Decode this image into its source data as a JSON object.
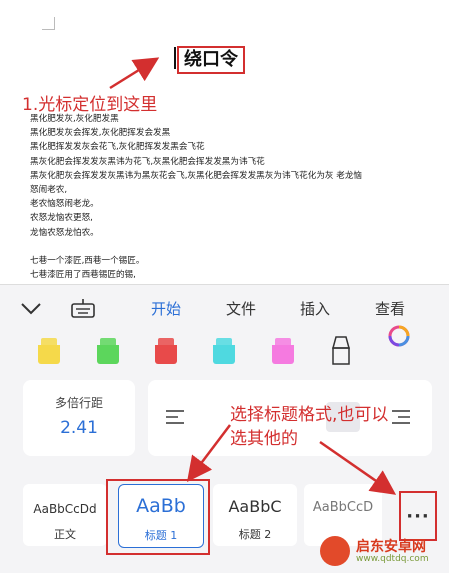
{
  "document": {
    "title": "绕口令",
    "lines": [
      "黑化肥发灰,灰化肥发黑",
      "黑化肥发灰会挥发,灰化肥挥发会发黑",
      "黑化肥挥发发灰会花飞,灰化肥挥发发黑会飞花",
      "黑灰化肥会挥发发灰黑讳为花飞,灰黑化肥会挥发发黑为讳飞花",
      "黑灰化肥灰会挥发发灰黑讳为黑灰花会飞,灰黑化肥会挥发发黑灰为讳飞花化为灰  老龙恼",
      "怒闹老农,",
      "老农恼怒闹老龙。",
      "农怒龙恼农更怒,",
      "龙恼农怒龙怕农。",
      "",
      "七巷一个漆匠,西巷一个锡匠。",
      "七巷漆匠用了西巷锡匠的锡,"
    ]
  },
  "annotations": {
    "cursor_note": "1.光标定位到这里",
    "style_note_line1": "选择标题格式,也可以",
    "style_note_line2": "选其他的"
  },
  "toolbar": {
    "collapse_icon": "chevron-down-icon",
    "keyboard_icon": "keyboard-icon",
    "tabs": [
      "开始",
      "文件",
      "插入",
      "查看"
    ],
    "active_tab": "开始",
    "accent": "#2b6fd6"
  },
  "highlight_colors": [
    "#f5d94a",
    "#5cd65c",
    "#e84a4a",
    "#4fd9e0",
    "#f57ae0"
  ],
  "paragraph": {
    "spacing_label": "多倍行距",
    "spacing_value": "2.41"
  },
  "styles": [
    {
      "sample": "AaBbCcDd",
      "name": "正文"
    },
    {
      "sample": "AaBb",
      "name": "标题 1"
    },
    {
      "sample": "AaBbC",
      "name": "标题 2"
    },
    {
      "sample": "AaBbCcD",
      "name": ""
    }
  ],
  "more_label": "···",
  "watermark": {
    "name": "启东安卓网",
    "url": "www.qdtdq.com"
  }
}
